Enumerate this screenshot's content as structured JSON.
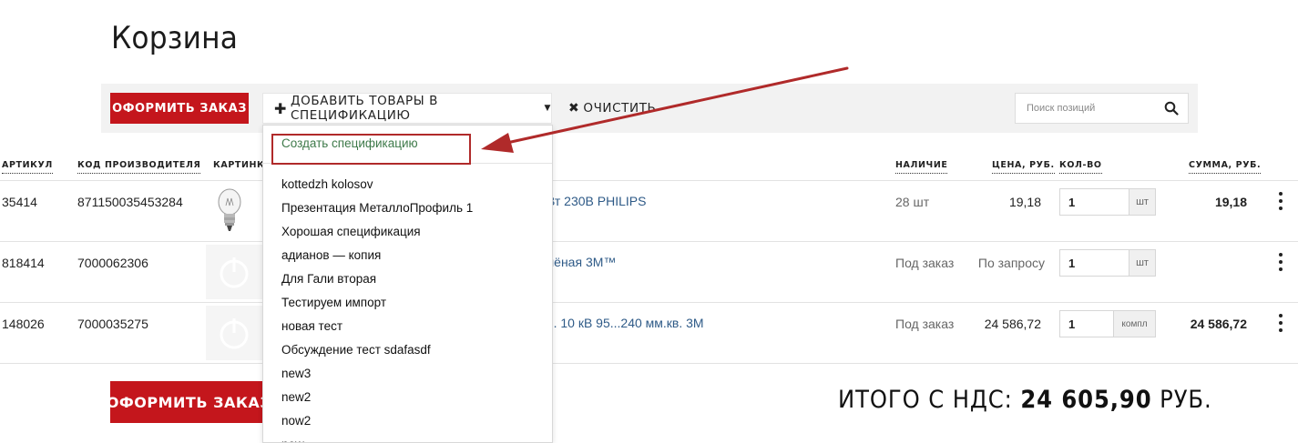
{
  "page": {
    "title": "Корзина"
  },
  "toolbar": {
    "order_label": "ОФОРМИТЬ ЗАКАЗ",
    "add_spec_label": "ДОБАВИТЬ ТОВАРЫ В СПЕЦИФИКАЦИЮ",
    "clear_label": "ОЧИСТИТЬ",
    "search_placeholder": "Поиск позиций"
  },
  "table": {
    "headers": {
      "article": "АРТИКУЛ",
      "maker_code": "КОД ПРОИЗВОДИТЕЛЯ",
      "picture": "КАРТИНКА",
      "availability": "НАЛИЧИЕ",
      "price": "ЦЕНА, РУБ.",
      "qty": "КОЛ-ВО",
      "sum": "СУММА, РУБ."
    },
    "rows": [
      {
        "article": "35414",
        "maker_code": "871150035453284",
        "picture": "bulb",
        "name": "Вт 230В PHILIPS",
        "availability": "28 шт",
        "price": "19,18",
        "qty": "1",
        "unit": "шт",
        "sum": "19,18"
      },
      {
        "article": "818414",
        "maker_code": "7000062306",
        "picture": "placeholder",
        "name": "лёная 3M™",
        "availability": "Под заказ",
        "price": "По запросу",
        "qty": "1",
        "unit": "шт",
        "sum": ""
      },
      {
        "article": "148026",
        "maker_code": "7000035275",
        "picture": "placeholder",
        "name": "п. 10 кВ 95...240 мм.кв. 3M",
        "availability": "Под заказ",
        "price": "24 586,72",
        "qty": "1",
        "unit": "компл",
        "sum": "24 586,72"
      }
    ]
  },
  "footer": {
    "order_label": "ОФОРМИТЬ ЗАКАЗ",
    "total_label": "ИТОГО С НДС:",
    "total_value": "24 605,90",
    "total_currency": "РУБ."
  },
  "dropdown": {
    "create_label": "Создать спецификацию",
    "items": [
      "kottedzh kolosov",
      "Презентация МеталлоПрофиль 1",
      "Хорошая спецификация",
      "адианов — копия",
      "Для Гали вторая",
      "Тестируем импорт",
      "новая тест",
      "Обсуждение тест sdafasdf",
      "new3",
      "new2",
      "now2",
      "new"
    ]
  },
  "annotation": {
    "color": "#b02a2a"
  },
  "colors": {
    "accent": "#c4161c",
    "link": "#2e5a87",
    "spec_create": "#3e7a4a"
  },
  "icons": {
    "search": "search-icon",
    "add": "plus-icon",
    "clear": "close-icon",
    "menu": "more-vertical-icon",
    "caret": "caret-down-icon"
  }
}
